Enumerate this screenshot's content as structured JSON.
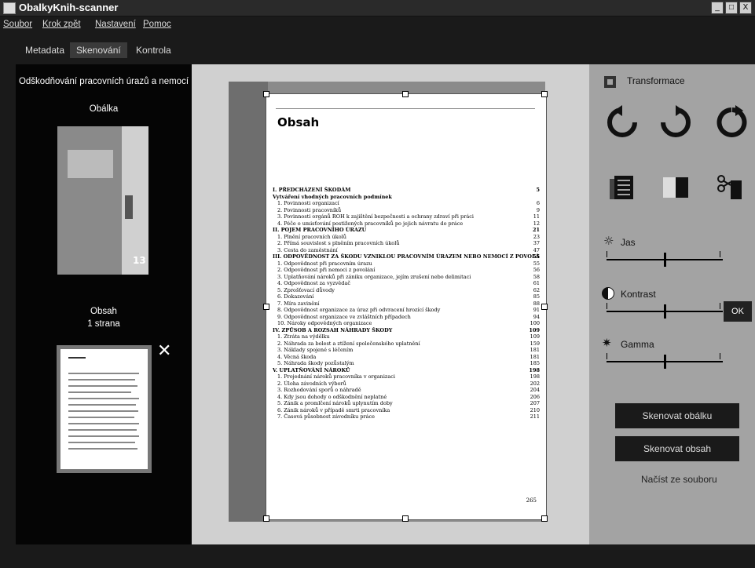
{
  "window": {
    "title": "ObalkyKnih-scanner",
    "buttons": [
      "_",
      "□",
      "X"
    ]
  },
  "menu": [
    "Soubor",
    "Krok zpět",
    "Nastavení",
    "Pomoc"
  ],
  "tabs": [
    {
      "label": "Metadata"
    },
    {
      "label": "Skenování"
    },
    {
      "label": "Kontrola"
    }
  ],
  "sidebar": {
    "book_title": "Odškodňování pracovních úrazů a nemocí",
    "cover_label": "Obálka",
    "cover_number": "13",
    "toc_label": "Obsah",
    "toc_pages": "1 strana",
    "remove_symbol": "✕"
  },
  "page": {
    "heading": "Obsah",
    "toc": [
      {
        "text": "I. PŘEDCHÁZENÍ ŠKODÁM",
        "page": "5",
        "cls": "sec"
      },
      {
        "text": "Vytváření vhodných pracovních podmínek",
        "page": "",
        "cls": "sec"
      },
      {
        "text": "1. Povinnosti organizací",
        "page": "6",
        "cls": "sub"
      },
      {
        "text": "2. Povinnosti pracovníků",
        "page": "9",
        "cls": "sub"
      },
      {
        "text": "3. Povinnosti orgánů ROH k zajištění bezpečnosti a ochrany zdraví při práci",
        "page": "11",
        "cls": "sub"
      },
      {
        "text": "4. Péče o umisťování postižených pracovníků po jejich návratu do práce",
        "page": "12",
        "cls": "sub"
      },
      {
        "text": "II. POJEM PRACOVNÍHO ÚRAZU",
        "page": "21",
        "cls": "sec"
      },
      {
        "text": "1. Plnění pracovních úkolů",
        "page": "23",
        "cls": "sub"
      },
      {
        "text": "2. Přímá souvislost s plněním pracovních úkolů",
        "page": "37",
        "cls": "sub"
      },
      {
        "text": "3. Cesta do zaměstnání",
        "page": "47",
        "cls": "sub"
      },
      {
        "text": "III. ODPOVĚDNOST ZA ŠKODU VZNIKLOU PRACOVNÍM ÚRAZEM NEBO NEMOCÍ Z POVOLÁNÍ",
        "page": "55",
        "cls": "sec"
      },
      {
        "text": "1. Odpovědnost při pracovním úrazu",
        "page": "55",
        "cls": "sub"
      },
      {
        "text": "2. Odpovědnost při nemoci z povolání",
        "page": "56",
        "cls": "sub"
      },
      {
        "text": "3. Uplatňování nároků při zániku organizace, jejím zrušení nebo delimitaci",
        "page": "58",
        "cls": "sub"
      },
      {
        "text": "4. Odpovědnost za vyzvědač",
        "page": "61",
        "cls": "sub"
      },
      {
        "text": "5. Zprošťovací důvody",
        "page": "62",
        "cls": "sub"
      },
      {
        "text": "6. Dokazování",
        "page": "85",
        "cls": "sub"
      },
      {
        "text": "7. Míra zavinění",
        "page": "88",
        "cls": "sub"
      },
      {
        "text": "8. Odpovědnost organizace za úraz při odvracení hrozící škody",
        "page": "91",
        "cls": "sub"
      },
      {
        "text": "9. Odpovědnost organizace ve zvláštních případech",
        "page": "94",
        "cls": "sub"
      },
      {
        "text": "10. Nároky odpovědných organizace",
        "page": "100",
        "cls": "sub"
      },
      {
        "text": "IV. ZPŮSOB A ROZSAH NÁHRADY ŠKODY",
        "page": "109",
        "cls": "sec"
      },
      {
        "text": "1. Ztráta na výdělku",
        "page": "109",
        "cls": "sub"
      },
      {
        "text": "2. Náhrada za bolest a ztížení společenského uplatnění",
        "page": "159",
        "cls": "sub"
      },
      {
        "text": "3. Náklady spojené s léčením",
        "page": "181",
        "cls": "sub"
      },
      {
        "text": "4. Věcná škoda",
        "page": "181",
        "cls": "sub"
      },
      {
        "text": "5. Náhrada škody pozůstalým",
        "page": "185",
        "cls": "sub"
      },
      {
        "text": "V. UPLATŇOVÁNÍ NÁROKŮ",
        "page": "198",
        "cls": "sec"
      },
      {
        "text": "1. Projednání nároků pracovníka v organizaci",
        "page": "198",
        "cls": "sub"
      },
      {
        "text": "2. Úloha závodních výborů",
        "page": "202",
        "cls": "sub"
      },
      {
        "text": "3. Rozhodování sporů o náhradě",
        "page": "204",
        "cls": "sub"
      },
      {
        "text": "4. Kdy jsou dohody o odškodnění neplatné",
        "page": "206",
        "cls": "sub"
      },
      {
        "text": "5. Zánik a promlčení nároků uplynutím doby",
        "page": "207",
        "cls": "sub"
      },
      {
        "text": "6. Zánik nároků v případě smrti pracovníka",
        "page": "210",
        "cls": "sub"
      },
      {
        "text": "7. Časová působnost závodníku práce",
        "page": "211",
        "cls": "sub"
      }
    ],
    "page_number": "265"
  },
  "transform": {
    "title": "Transformace",
    "brightness": "Jas",
    "contrast": "Kontrast",
    "gamma": "Gamma",
    "ok": "OK",
    "brightness_level": 0.5,
    "contrast_level": 0.5,
    "gamma_level": 0.5
  },
  "actions": {
    "scan_cover": "Skenovat obálku",
    "scan_toc": "Skenovat obsah",
    "load_file": "Načíst ze souboru"
  }
}
